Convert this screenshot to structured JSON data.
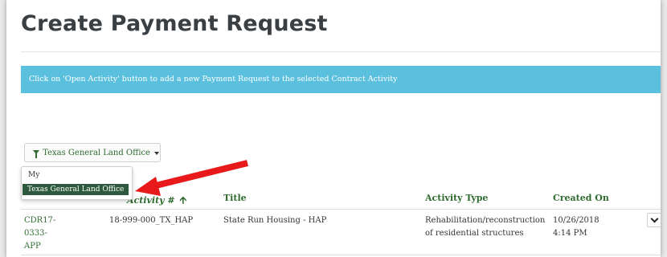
{
  "page": {
    "title": "Create Payment Request"
  },
  "info": {
    "message": "Click on 'Open Activity' button to add a new Payment Request to the selected Contract Activity"
  },
  "filter": {
    "label": "Texas General Land Office",
    "options": [
      "My",
      "Texas General Land Office"
    ],
    "selected": "Texas General Land Office"
  },
  "table": {
    "headers": {
      "activity": "Activity #",
      "title": "Title",
      "activity_type": "Activity Type",
      "created_on": "Created On"
    },
    "rows": [
      {
        "id_line1": "CDR17-",
        "id_line2": "0333-",
        "id_line3": "APP",
        "activity": "18-999-000_TX_HAP",
        "title": "State Run Housing - HAP",
        "activity_type": "Rehabilitation/reconstruction of residential structures",
        "created_on": "10/26/2018 4:14 PM"
      }
    ]
  },
  "colors": {
    "accent_green": "#2f6b2f",
    "info_blue": "#5bc0de",
    "selected_bg": "#2d5a3e",
    "arrow_red": "#e8191a"
  },
  "icons": {
    "filter": "funnel-icon",
    "sort": "sort-up-arrow-icon",
    "expand": "chevron-down-icon"
  }
}
